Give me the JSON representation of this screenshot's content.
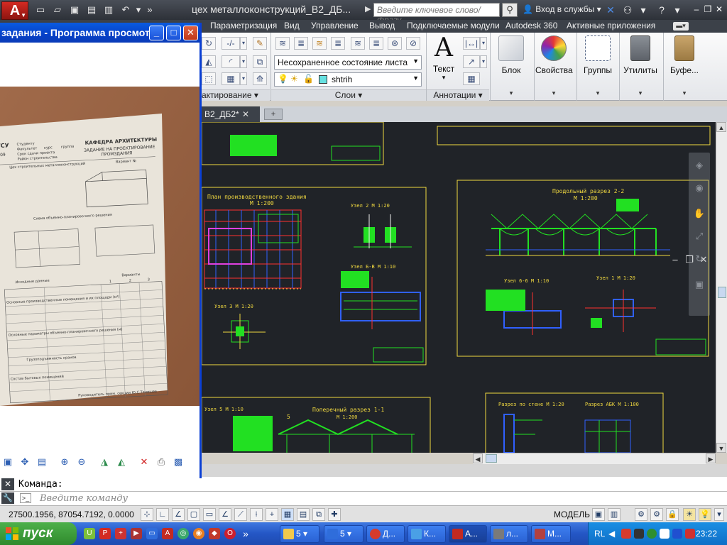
{
  "titlebar": {
    "app_logo_letter": "A",
    "doc_title": "цех металлоконструкций_В2_ДБ...",
    "search_placeholder": "Введите ключевое слово/фразу",
    "signin_label": "Вход в службы"
  },
  "ribbon": {
    "tabs": [
      "Параметризация",
      "Вид",
      "Управление",
      "Вывод",
      "Подключаемые модули",
      "Autodesk 360",
      "Активные приложения"
    ],
    "layer_state": "Несохраненное состояние листа",
    "current_layer": "shtrih",
    "panels": {
      "modify": "актирование",
      "layers": "Слои",
      "annotations": "Аннотации"
    },
    "big_buttons": {
      "text_glyph": "A",
      "text": "Текст",
      "block": "Блок",
      "properties": "Свойства",
      "groups": "Группы",
      "utilities": "Утилиты",
      "clipboard": "Буфе..."
    }
  },
  "document": {
    "tab_label": "В2_ДБ2*"
  },
  "viewer": {
    "title": "задания - Программа просмот..."
  },
  "photo_sheet": {
    "header_title": "КАФЕДРА АРХИТЕКТУРЫ",
    "header_sub1": "ЗАДАНИЕ НА ПРОЕКТИРОВАНИЕ",
    "header_sub2": "ПРОМЗДАНИЯ",
    "logo": "ГСУ",
    "year": "009",
    "field_student": "Студенту",
    "field_faculty": "Факультет",
    "field_course": "курс",
    "field_group": "группа",
    "field_deadline": "Срок сдачи проекта",
    "field_region": "Район строительства",
    "variant": "Вариант №",
    "building_name": "Цех строительных металлоконструкций",
    "scheme_caption": "Схема объемно-планировочного решения",
    "source_data": "Исходные данные",
    "variants": "Варианты",
    "col_numbers": [
      "1",
      "2",
      "3"
    ],
    "params_caption": "Основные параметры объемно-планировочного решения (м)",
    "cranes_caption": "Грузоподъемность кранов",
    "main_premises": "Основные производственные помещения и их площади (м²)",
    "stuff": "Состав бытовых помещений",
    "footer": "Руководитель прим. секции Ю.С.Тенишев"
  },
  "drawing": {
    "sheet_labels": {
      "plan": "План производственного здания",
      "plan_scale": "М 1:200",
      "section22": "Продольный разрез 2-2",
      "section22_scale": "М 1:200",
      "node2": "Узел 2  М 1:20",
      "node_bb": "Узел Б-В  М 1:10",
      "node3": "Узел 3  М 1:20",
      "node66": "Узел 6-6  М 1:10",
      "node1": "Узел 1  М 1:20",
      "node5": "Узел 5  М 1:10",
      "cross11": "Поперечный разрез 1-1",
      "cross11_scale": "М 1:200",
      "wall_cut": "Разрез по стене  М 1:20",
      "abk_cut": "Разрез АБК  М 1:100",
      "marker5": "5"
    }
  },
  "command": {
    "history": "Команда:",
    "placeholder": "Введите команду"
  },
  "statusbar": {
    "coords": "27500.1956, 87054.7192, 0.0000",
    "model_label": "МОДЕЛЬ"
  },
  "taskbar": {
    "start_label": "пуск",
    "tasks": [
      {
        "label": "5",
        "color": "#f2c94c"
      },
      {
        "label": "5",
        "color": "#2f6ddb"
      },
      {
        "label": "Д...",
        "color": "#d63b2c"
      },
      {
        "label": "К...",
        "color": "#4aa0e6"
      },
      {
        "label": "А...",
        "color": "#c22a22"
      },
      {
        "label": "л...",
        "color": "#7a7a7a"
      },
      {
        "label": "М...",
        "color": "#b24040"
      }
    ],
    "lang": "RL",
    "clock": "23:22"
  },
  "colors": {
    "drawing_bg": "#202328",
    "cad_green": "#22e022",
    "cad_yellow": "#f0d840",
    "cad_red": "#ff3030",
    "cad_blue": "#3060ff",
    "cad_magenta": "#e040e0"
  }
}
